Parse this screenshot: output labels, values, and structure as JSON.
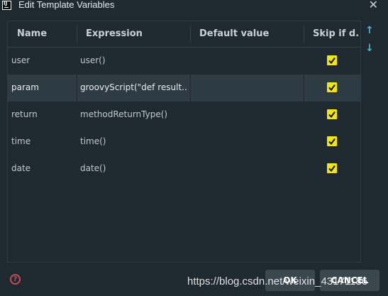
{
  "window": {
    "title": "Edit Template Variables",
    "close_label": "✕"
  },
  "table": {
    "headers": {
      "name": "Name",
      "expression": "Expression",
      "default_value": "Default value",
      "skip": "Skip if d..."
    },
    "rows": [
      {
        "name": "user",
        "expression": "user()",
        "default_value": "",
        "skip": true
      },
      {
        "name": "param",
        "expression": "groovyScript(\"def result...",
        "default_value": "",
        "skip": true
      },
      {
        "name": "return",
        "expression": "methodReturnType()",
        "default_value": "",
        "skip": true
      },
      {
        "name": "time",
        "expression": "time()",
        "default_value": "",
        "skip": true
      },
      {
        "name": "date",
        "expression": "date()",
        "default_value": "",
        "skip": true
      }
    ],
    "selected_row_index": 1
  },
  "side_controls": {
    "move_up": "↑",
    "move_down": "↓"
  },
  "footer": {
    "help_label": "?",
    "ok_label": "OK",
    "cancel_label": "CANCEL"
  },
  "watermark": "https://blog.csdn.net/weixin_43171186",
  "colors": {
    "background": "#1f2a30",
    "selected_row": "#2d3b42",
    "checkbox": "#f3e600",
    "arrows": "#4fb6c9",
    "help": "#c94a57"
  }
}
